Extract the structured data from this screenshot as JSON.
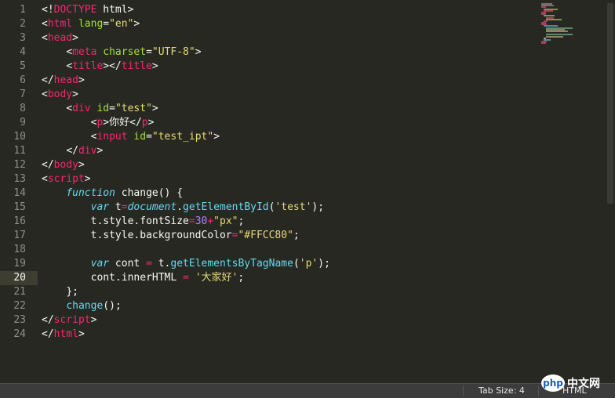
{
  "editor": {
    "line_numbers": [
      "1",
      "2",
      "3",
      "4",
      "5",
      "6",
      "7",
      "8",
      "9",
      "10",
      "11",
      "12",
      "13",
      "14",
      "15",
      "16",
      "17",
      "18",
      "19",
      "20",
      "21",
      "22",
      "23",
      "24"
    ],
    "current_line": "20",
    "code": {
      "l1": [
        "<!",
        "DOCTYPE",
        " html>"
      ],
      "l2": [
        "<",
        "html",
        " ",
        "lang",
        "=",
        "\"en\"",
        ">"
      ],
      "l3": [
        "<",
        "head",
        ">"
      ],
      "l4": [
        "<",
        "meta",
        " ",
        "charset",
        "=",
        "\"UTF-8\"",
        ">"
      ],
      "l5": [
        "<",
        "title",
        "></",
        "title",
        ">"
      ],
      "l6": [
        "</",
        "head",
        ">"
      ],
      "l7": [
        "<",
        "body",
        ">"
      ],
      "l8": [
        "<",
        "div",
        " ",
        "id",
        "=",
        "\"test\"",
        ">"
      ],
      "l9": [
        "<",
        "p",
        ">",
        "你好",
        "</",
        "p",
        ">"
      ],
      "l10": [
        "<",
        "input",
        " ",
        "id",
        "=",
        "\"test_ipt\"",
        ">"
      ],
      "l11": [
        "</",
        "div",
        ">"
      ],
      "l12": [
        "</",
        "body",
        ">"
      ],
      "l13": [
        "<",
        "script",
        ">"
      ],
      "l14": [
        "function",
        " ",
        "change",
        "() {"
      ],
      "l15": [
        "var",
        " t",
        "=",
        "document",
        ".",
        "getElementById",
        "(",
        "'test'",
        ");"
      ],
      "l16": [
        "t.style.fontSize",
        "=",
        "30",
        "+",
        "\"px\"",
        ";"
      ],
      "l17": [
        "t.style.backgroundColor",
        "=",
        "\"#FFCC80\"",
        ";"
      ],
      "l18": [
        ""
      ],
      "l19": [
        "var",
        " cont ",
        "=",
        " t.",
        "getElementsByTagName",
        "(",
        "'p'",
        ");"
      ],
      "l20": [
        "cont.innerHTML ",
        "=",
        " ",
        "'大家好'",
        ";"
      ],
      "l21": [
        "};"
      ],
      "l22": [
        "change",
        "();"
      ],
      "l23": [
        "</",
        "script",
        ">"
      ],
      "l24": [
        "</",
        "html",
        ">"
      ]
    }
  },
  "statusbar": {
    "tab_size": "Tab Size: 4",
    "syntax": "HTML"
  },
  "watermark": {
    "logo": "php",
    "text": "中文网"
  },
  "colors": {
    "background": "#272822",
    "tag": "#F92672",
    "attribute": "#A6E22E",
    "string": "#E6DB74",
    "keyword": "#66D9EF",
    "number": "#AE81FF"
  }
}
